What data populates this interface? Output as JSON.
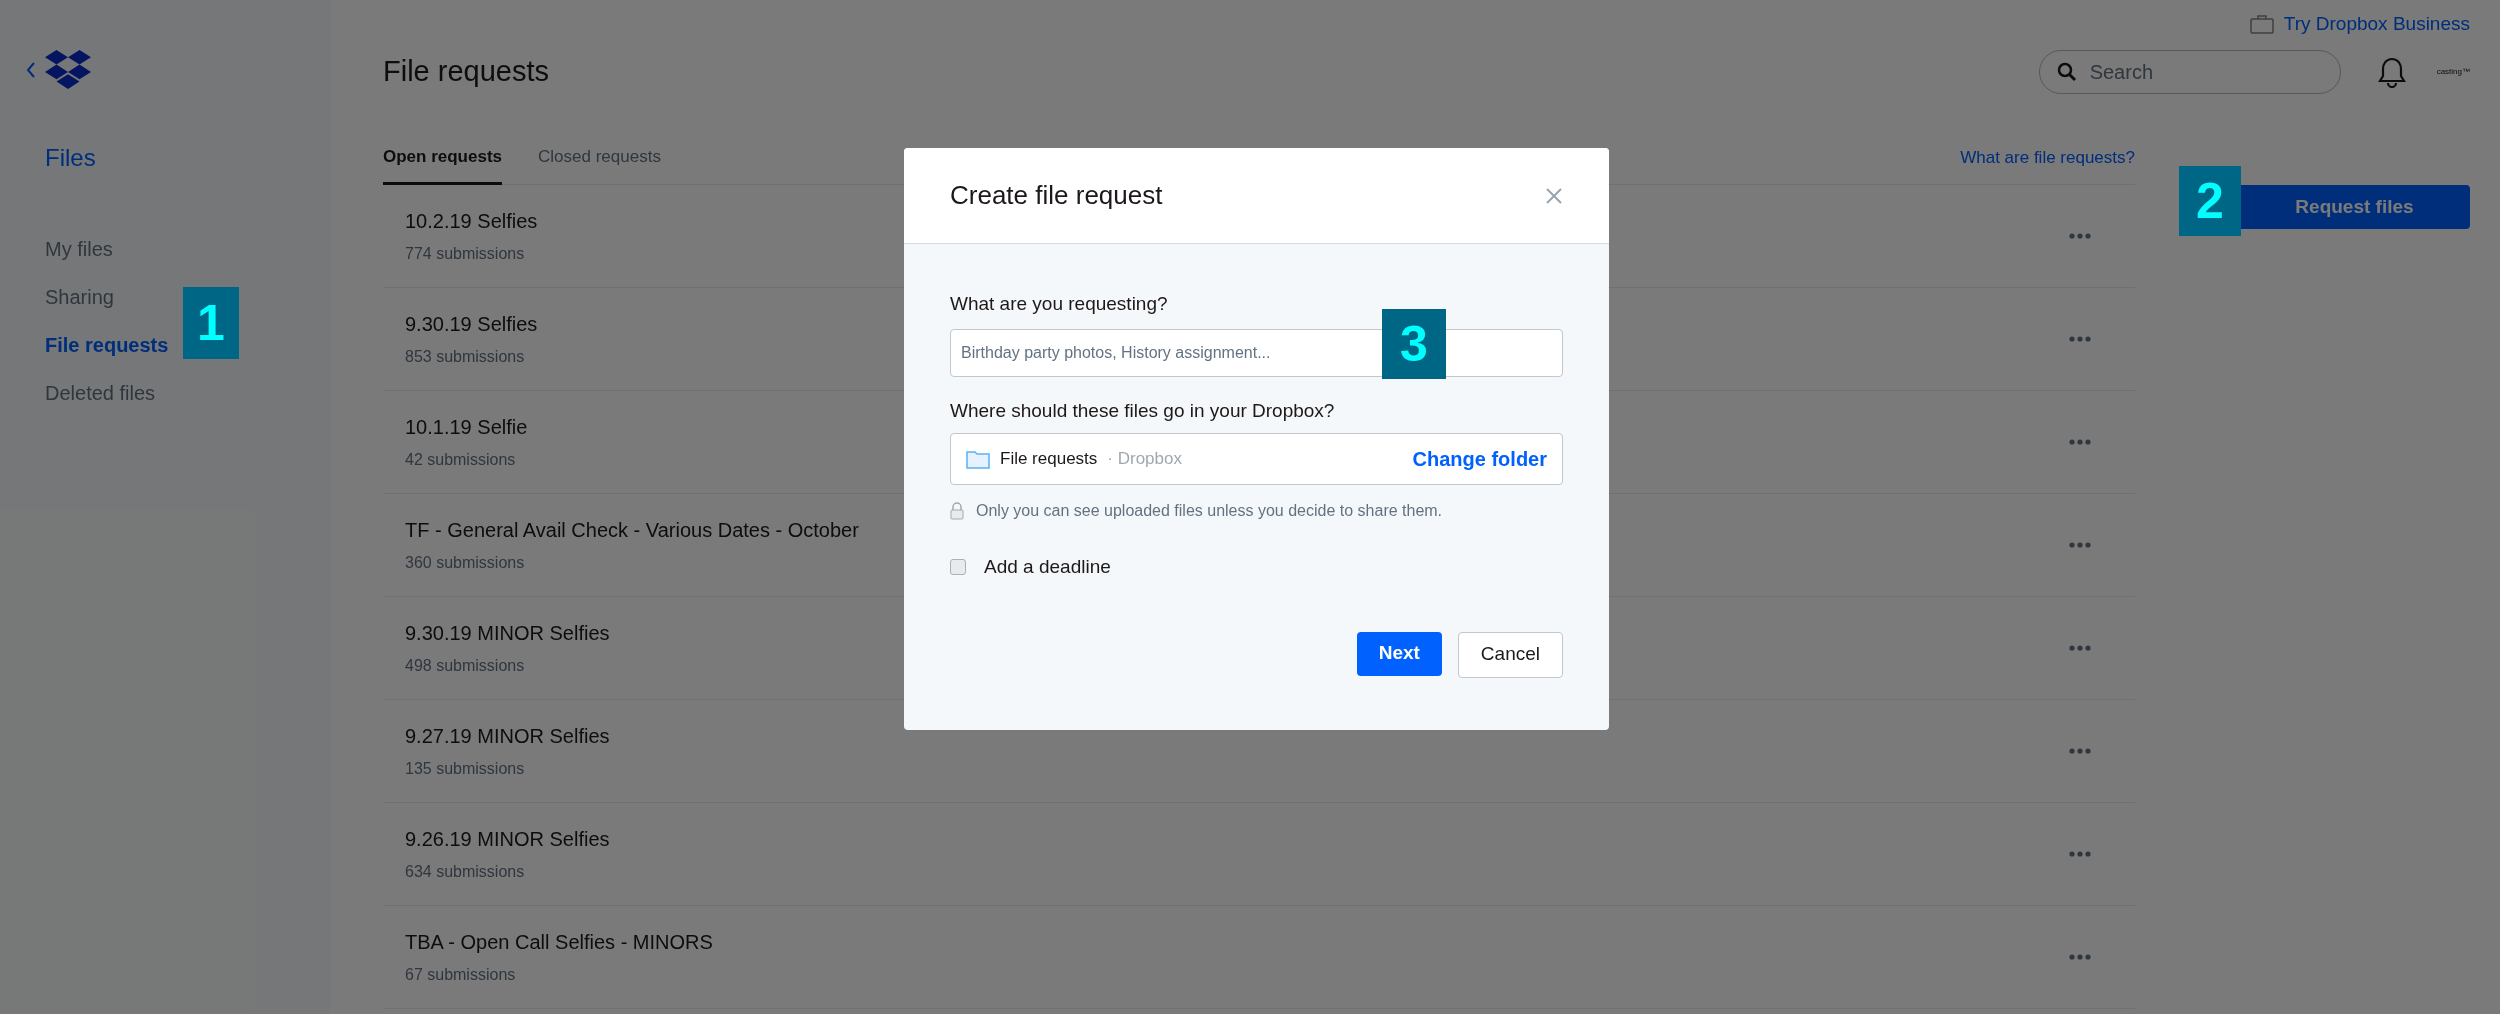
{
  "sidebar": {
    "heading": "Files",
    "items": [
      {
        "label": "My files",
        "selected": false
      },
      {
        "label": "Sharing",
        "selected": false
      },
      {
        "label": "File requests",
        "selected": true
      },
      {
        "label": "Deleted files",
        "selected": false
      }
    ]
  },
  "header": {
    "promo": "Try Dropbox Business",
    "title": "File requests",
    "search": {
      "placeholder": "Search"
    },
    "avatar": "casting™"
  },
  "tabs": [
    {
      "label": "Open requests",
      "selected": true
    },
    {
      "label": "Closed requests",
      "selected": false
    }
  ],
  "help_link": "What are file requests?",
  "rows": [
    {
      "title": "10.2.19 Selfies",
      "subtitle": "774 submissions"
    },
    {
      "title": "9.30.19 Selfies",
      "subtitle": "853 submissions"
    },
    {
      "title": "10.1.19 Selfie",
      "subtitle": "42 submissions"
    },
    {
      "title": "TF - General Avail Check - Various Dates - October",
      "subtitle": "360 submissions"
    },
    {
      "title": "9.30.19 MINOR Selfies",
      "subtitle": "498 submissions"
    },
    {
      "title": "9.27.19 MINOR Selfies",
      "subtitle": "135 submissions"
    },
    {
      "title": "9.26.19 MINOR Selfies",
      "subtitle": "634 submissions"
    },
    {
      "title": "TBA - Open Call Selfies - MINORS",
      "subtitle": "67 submissions"
    }
  ],
  "request_button": "Request files",
  "modal": {
    "title": "Create file request",
    "request_label": "What are you requesting?",
    "request_placeholder": "Birthday party photos, History assignment...",
    "folder_label": "Where should these files go in your Dropbox?",
    "folder_name": "File requests",
    "folder_location": "· Dropbox",
    "change_folder": "Change folder",
    "privacy_note": "Only you can see uploaded files unless you decide to share them.",
    "deadline": {
      "label": "Add a deadline",
      "checked": false
    },
    "buttons": [
      {
        "label": "Next",
        "kind": "primary"
      },
      {
        "label": "Cancel",
        "kind": "secondary"
      }
    ]
  },
  "callouts": [
    "1",
    "2",
    "3"
  ]
}
